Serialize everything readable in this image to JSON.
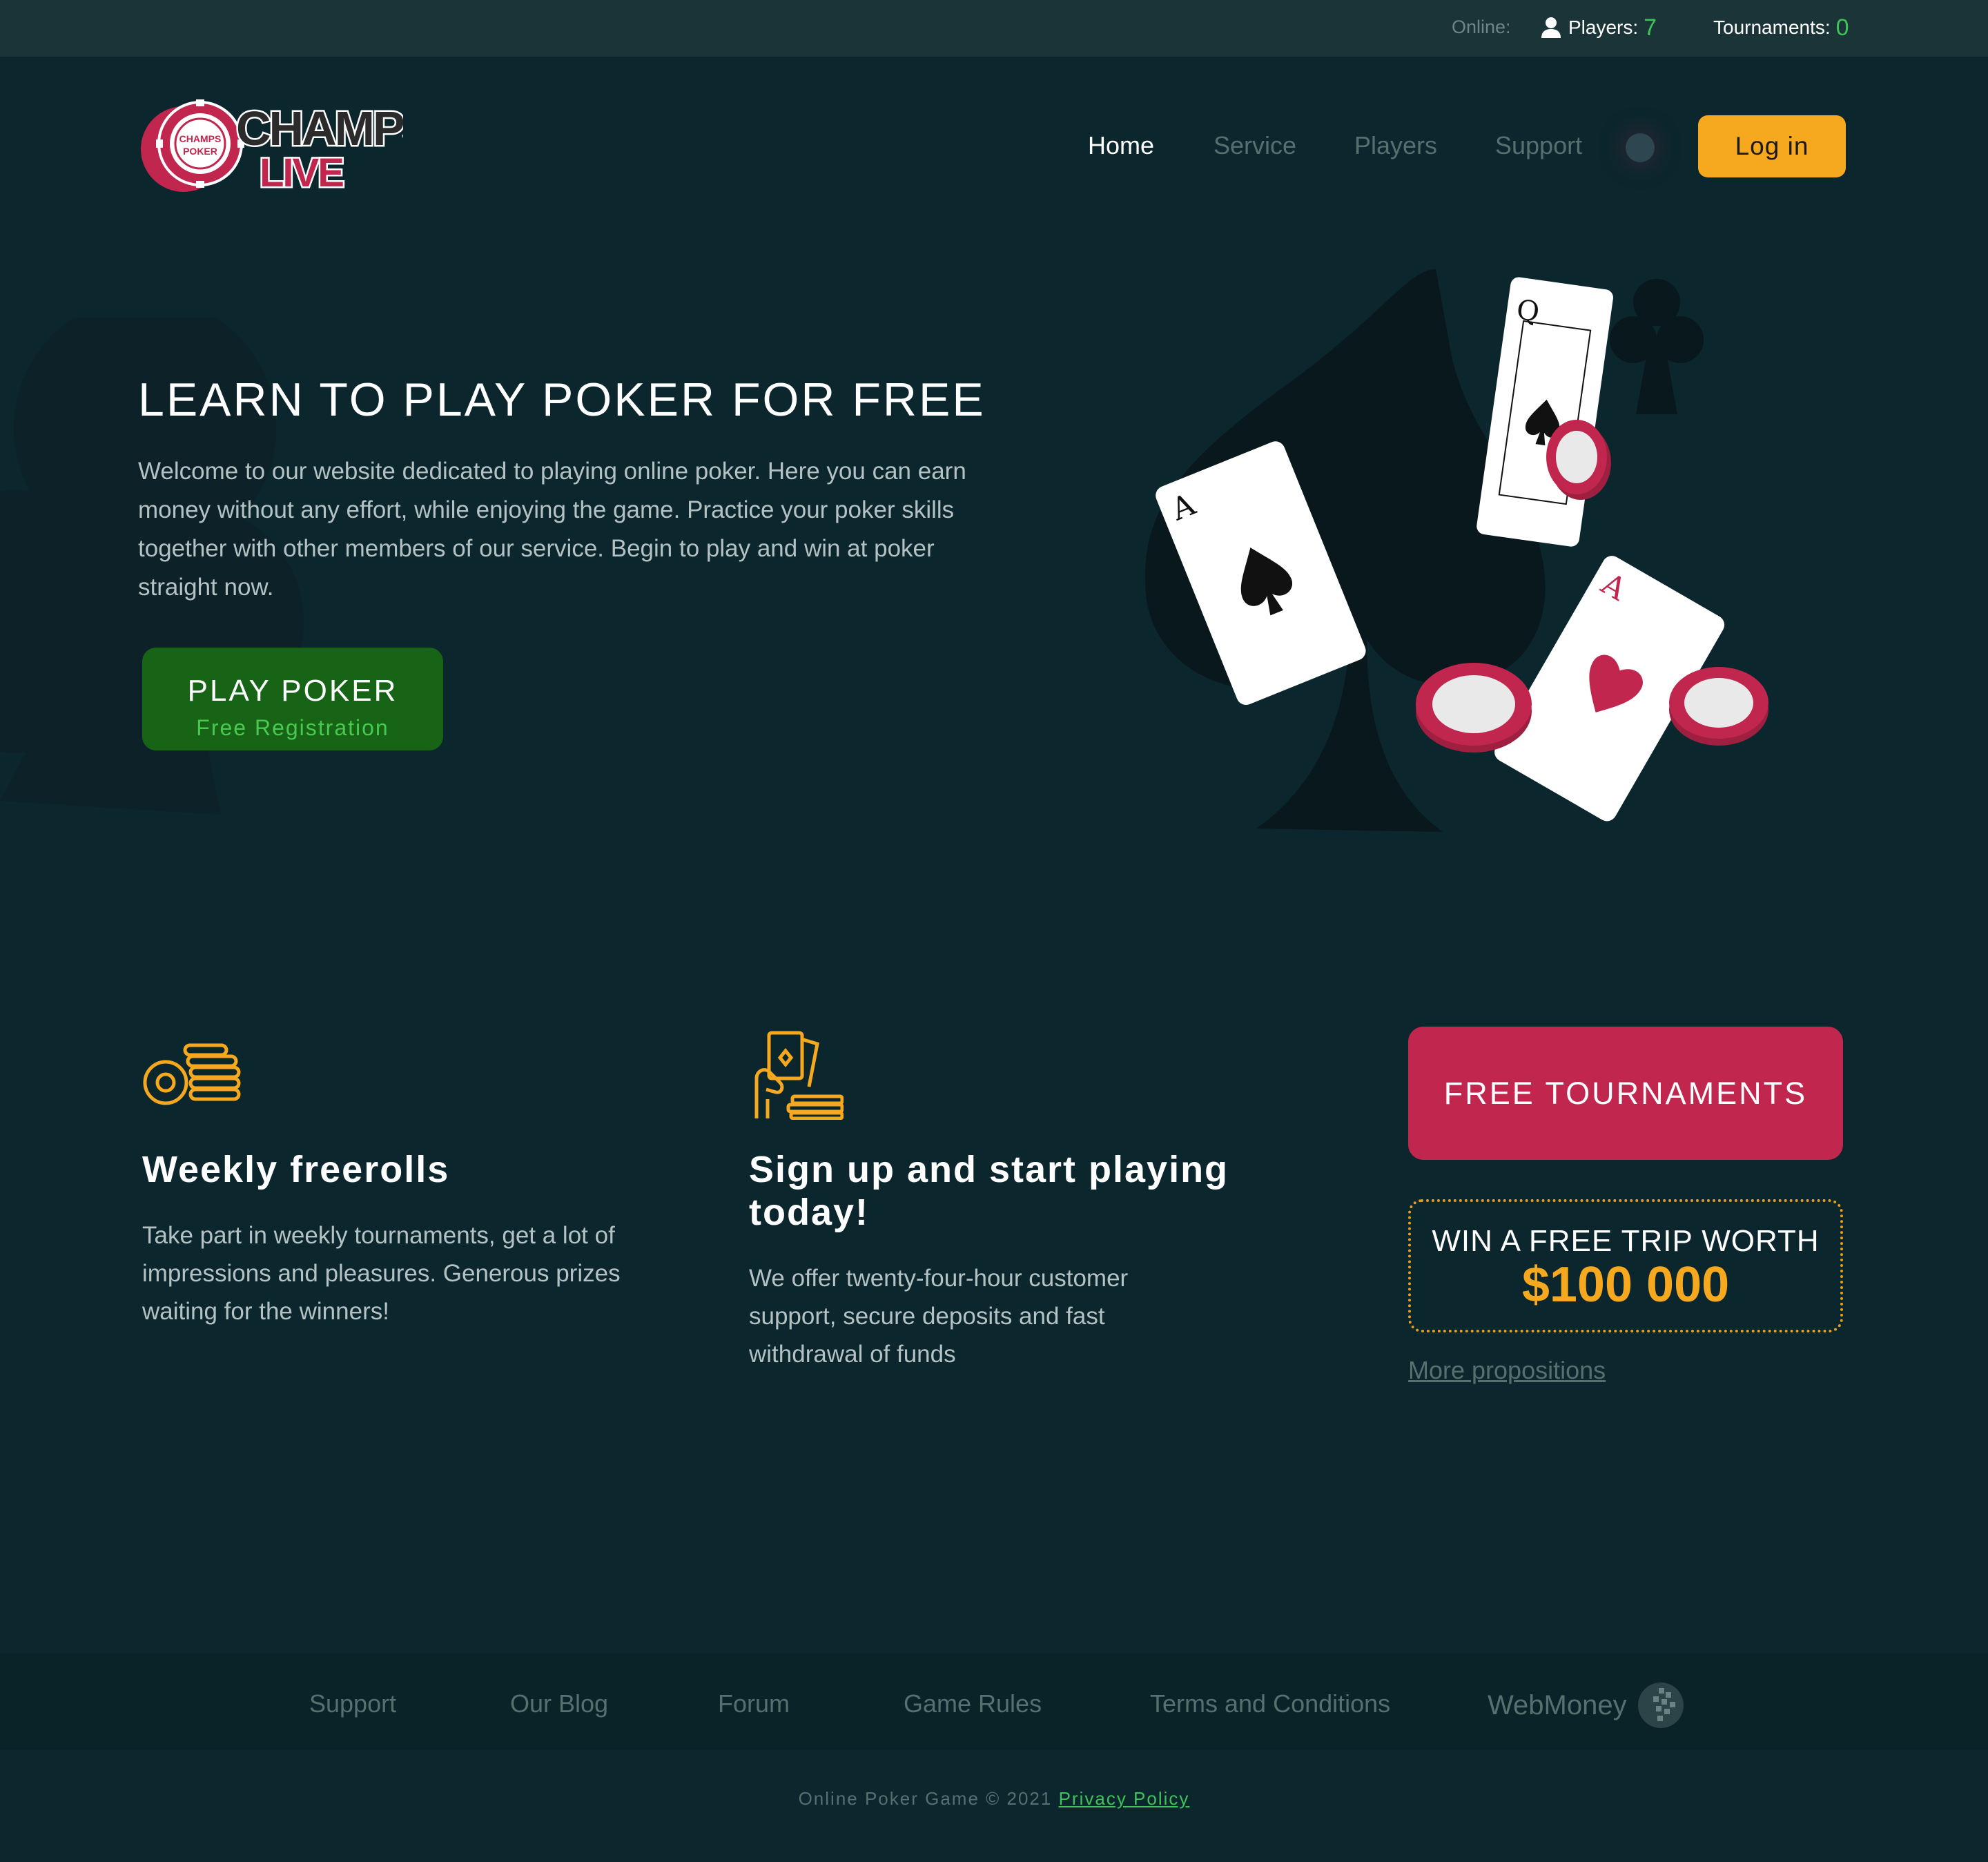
{
  "topbar": {
    "online_label": "Online:",
    "players_label": "Players:",
    "players_count": "7",
    "tournaments_label": "Tournaments:",
    "tournaments_count": "0"
  },
  "logo": {
    "chip_text_top": "CHAMPS",
    "chip_text_bottom": "POKER",
    "word1": "CHAMPS",
    "word2": "LIVE"
  },
  "nav": {
    "items": [
      "Home",
      "Service",
      "Players",
      "Support"
    ],
    "active": "Home",
    "login_label": "Log in"
  },
  "hero": {
    "title": "LEARN TO PLAY POKER FOR FREE",
    "text": "Welcome to our website dedicated to playing online poker. Here you can earn money without any effort, while enjoying the game. Practice your poker skills together with other members of our service. Begin to play and win at poker straight now.",
    "cta_line1": "PLAY POKER",
    "cta_line2": "Free Registration",
    "cards": [
      {
        "rank": "A",
        "suit": "spades"
      },
      {
        "rank": "Q",
        "suit": "spades"
      },
      {
        "rank": "A",
        "suit": "hearts"
      }
    ]
  },
  "features": [
    {
      "icon": "poker-chips-stack-icon",
      "title": "Weekly freerolls",
      "text": "Take part in weekly tournaments, get a lot of impressions and pleasures. Generous prizes waiting for the winners!"
    },
    {
      "icon": "hand-holding-cards-icon",
      "title": "Sign up and start playing today!",
      "text": "We offer twenty-four-hour customer support, secure deposits and fast withdrawal of funds"
    }
  ],
  "promo": {
    "free_tournaments_label": "FREE TOURNAMENTS",
    "trip_line1": "WIN A FREE TRIP WORTH",
    "trip_amount": "$100 000",
    "more_label": "More propositions"
  },
  "footer": {
    "links": [
      "Support",
      "Our Blog",
      "Forum",
      "Game Rules",
      "Terms and Conditions"
    ],
    "webmoney_label": "WebMoney",
    "copyright": "Online Poker Game © 2021",
    "privacy_label": "Privacy Policy"
  },
  "colors": {
    "background": "#0b262d",
    "topbar": "#1b3438",
    "accent_orange": "#f6a81e",
    "accent_red": "#c1274e",
    "accent_green": "#3ec25a",
    "cta_green": "#176417"
  }
}
